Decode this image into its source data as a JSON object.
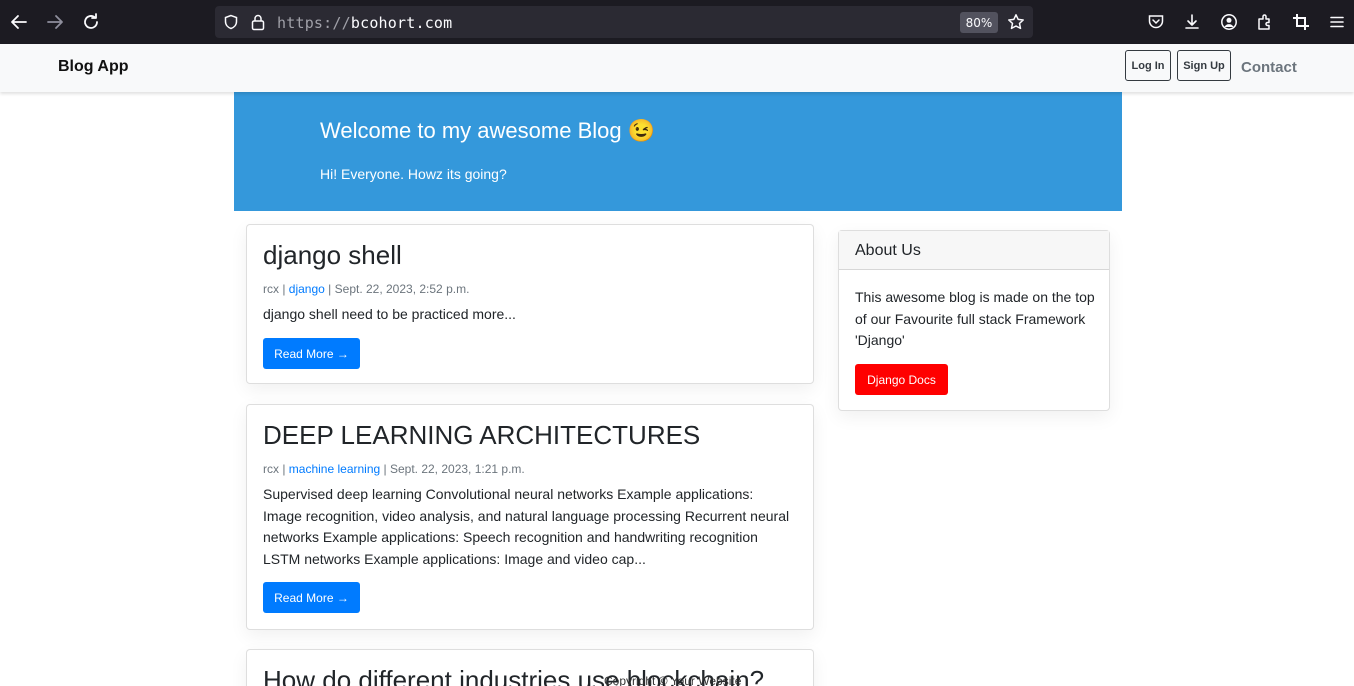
{
  "browser": {
    "url_scheme": "https://",
    "url_host": "bcohort.com",
    "zoom": "80%"
  },
  "navbar": {
    "brand": "Blog App",
    "login_label": "Log In",
    "signup_label": "Sign Up",
    "contact_label": "Contact"
  },
  "hero": {
    "title": "Welcome to my awesome Blog",
    "emoji": "😉",
    "subtitle": "Hi! Everyone. Howz its going?"
  },
  "posts": [
    {
      "title": "django shell",
      "author": "rcx",
      "category": "django",
      "date": "Sept. 22, 2023, 2:52 p.m.",
      "excerpt": "django shell need to be practiced more...",
      "read_more": "Read More →"
    },
    {
      "title": "DEEP LEARNING ARCHITECTURES",
      "author": "rcx",
      "category": "machine learning",
      "date": "Sept. 22, 2023, 1:21 p.m.",
      "excerpt": "Supervised deep learning Convolutional neural networks Example applications: Image recognition, video analysis, and natural language processing Recurrent neural networks Example applications: Speech recognition and handwriting recognition LSTM networks Example applications: Image and video cap...",
      "read_more": "Read More →"
    },
    {
      "title": "How do different industries use blockchain?"
    }
  ],
  "sidebar": {
    "header": "About Us",
    "text": "This awesome blog is made on the top of our Favourite full stack Framework 'Django'",
    "button": "Django Docs"
  },
  "footer": {
    "text": "Copyright © Your Website"
  },
  "colors": {
    "hero_bg": "#3498db",
    "primary": "#007bff",
    "danger": "#ff0000"
  }
}
